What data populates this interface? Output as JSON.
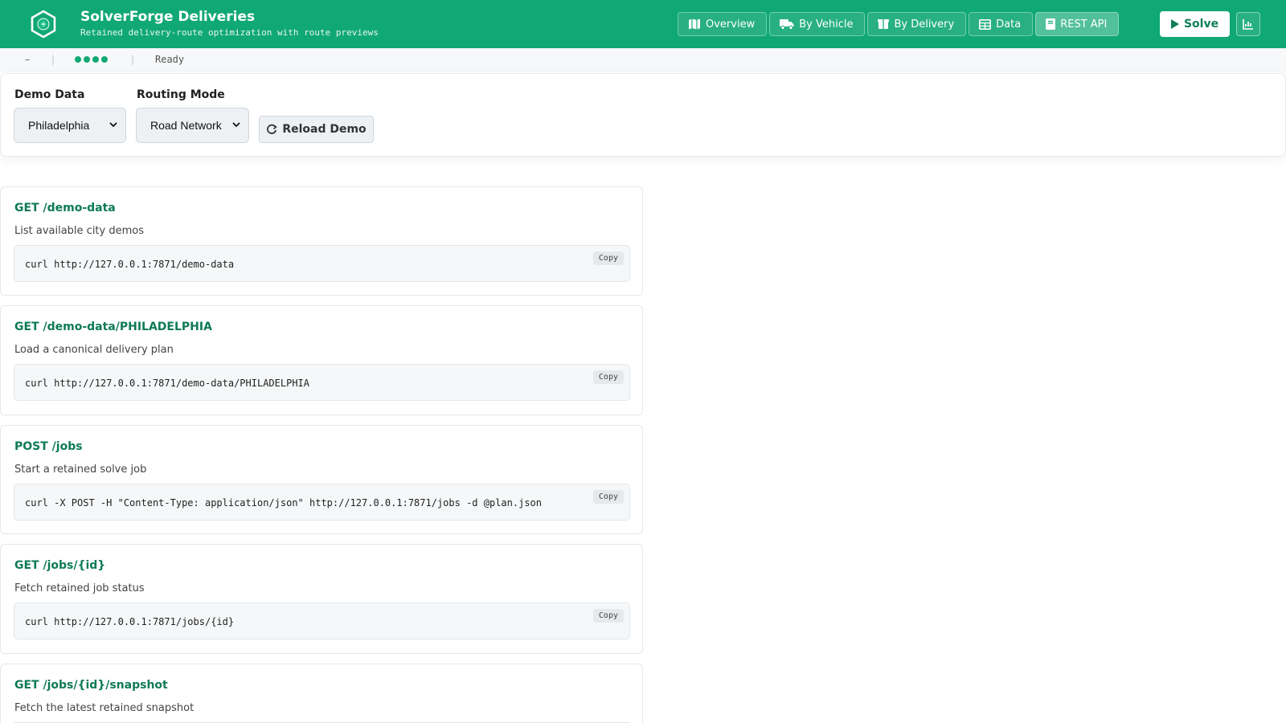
{
  "app": {
    "title": "SolverForge Deliveries",
    "subtitle": "Retained delivery-route optimization with route previews"
  },
  "nav": [
    {
      "label": "Overview",
      "icon": "map-icon"
    },
    {
      "label": "By Vehicle",
      "icon": "truck-icon"
    },
    {
      "label": "By Delivery",
      "icon": "box-icon"
    },
    {
      "label": "Data",
      "icon": "table-icon"
    },
    {
      "label": "REST API",
      "icon": "book-icon",
      "active": true
    }
  ],
  "actions": {
    "solve_label": "Solve",
    "chart_icon": "chart-icon"
  },
  "status": {
    "score": "–",
    "separator": "|",
    "text": "Ready"
  },
  "controls": {
    "demo_data_label": "Demo Data",
    "demo_data_value": "Philadelphia",
    "routing_mode_label": "Routing Mode",
    "routing_mode_value": "Road Network",
    "reload_label": "Reload Demo"
  },
  "endpoints": [
    {
      "title": "GET /demo-data",
      "description": "List available city demos",
      "command": "curl http://127.0.0.1:7871/demo-data",
      "copy_label": "Copy"
    },
    {
      "title": "GET /demo-data/PHILADELPHIA",
      "description": "Load a canonical delivery plan",
      "command": "curl http://127.0.0.1:7871/demo-data/PHILADELPHIA",
      "copy_label": "Copy"
    },
    {
      "title": "POST /jobs",
      "description": "Start a retained solve job",
      "command": "curl -X POST -H \"Content-Type: application/json\" http://127.0.0.1:7871/jobs -d @plan.json",
      "copy_label": "Copy"
    },
    {
      "title": "GET /jobs/{id}",
      "description": "Fetch retained job status",
      "command": "curl http://127.0.0.1:7871/jobs/{id}",
      "copy_label": "Copy"
    },
    {
      "title": "GET /jobs/{id}/snapshot",
      "description": "Fetch the latest retained snapshot",
      "command": "",
      "copy_label": ""
    }
  ],
  "colors": {
    "brand": "#10a874",
    "title_accent": "#0e7a55"
  }
}
